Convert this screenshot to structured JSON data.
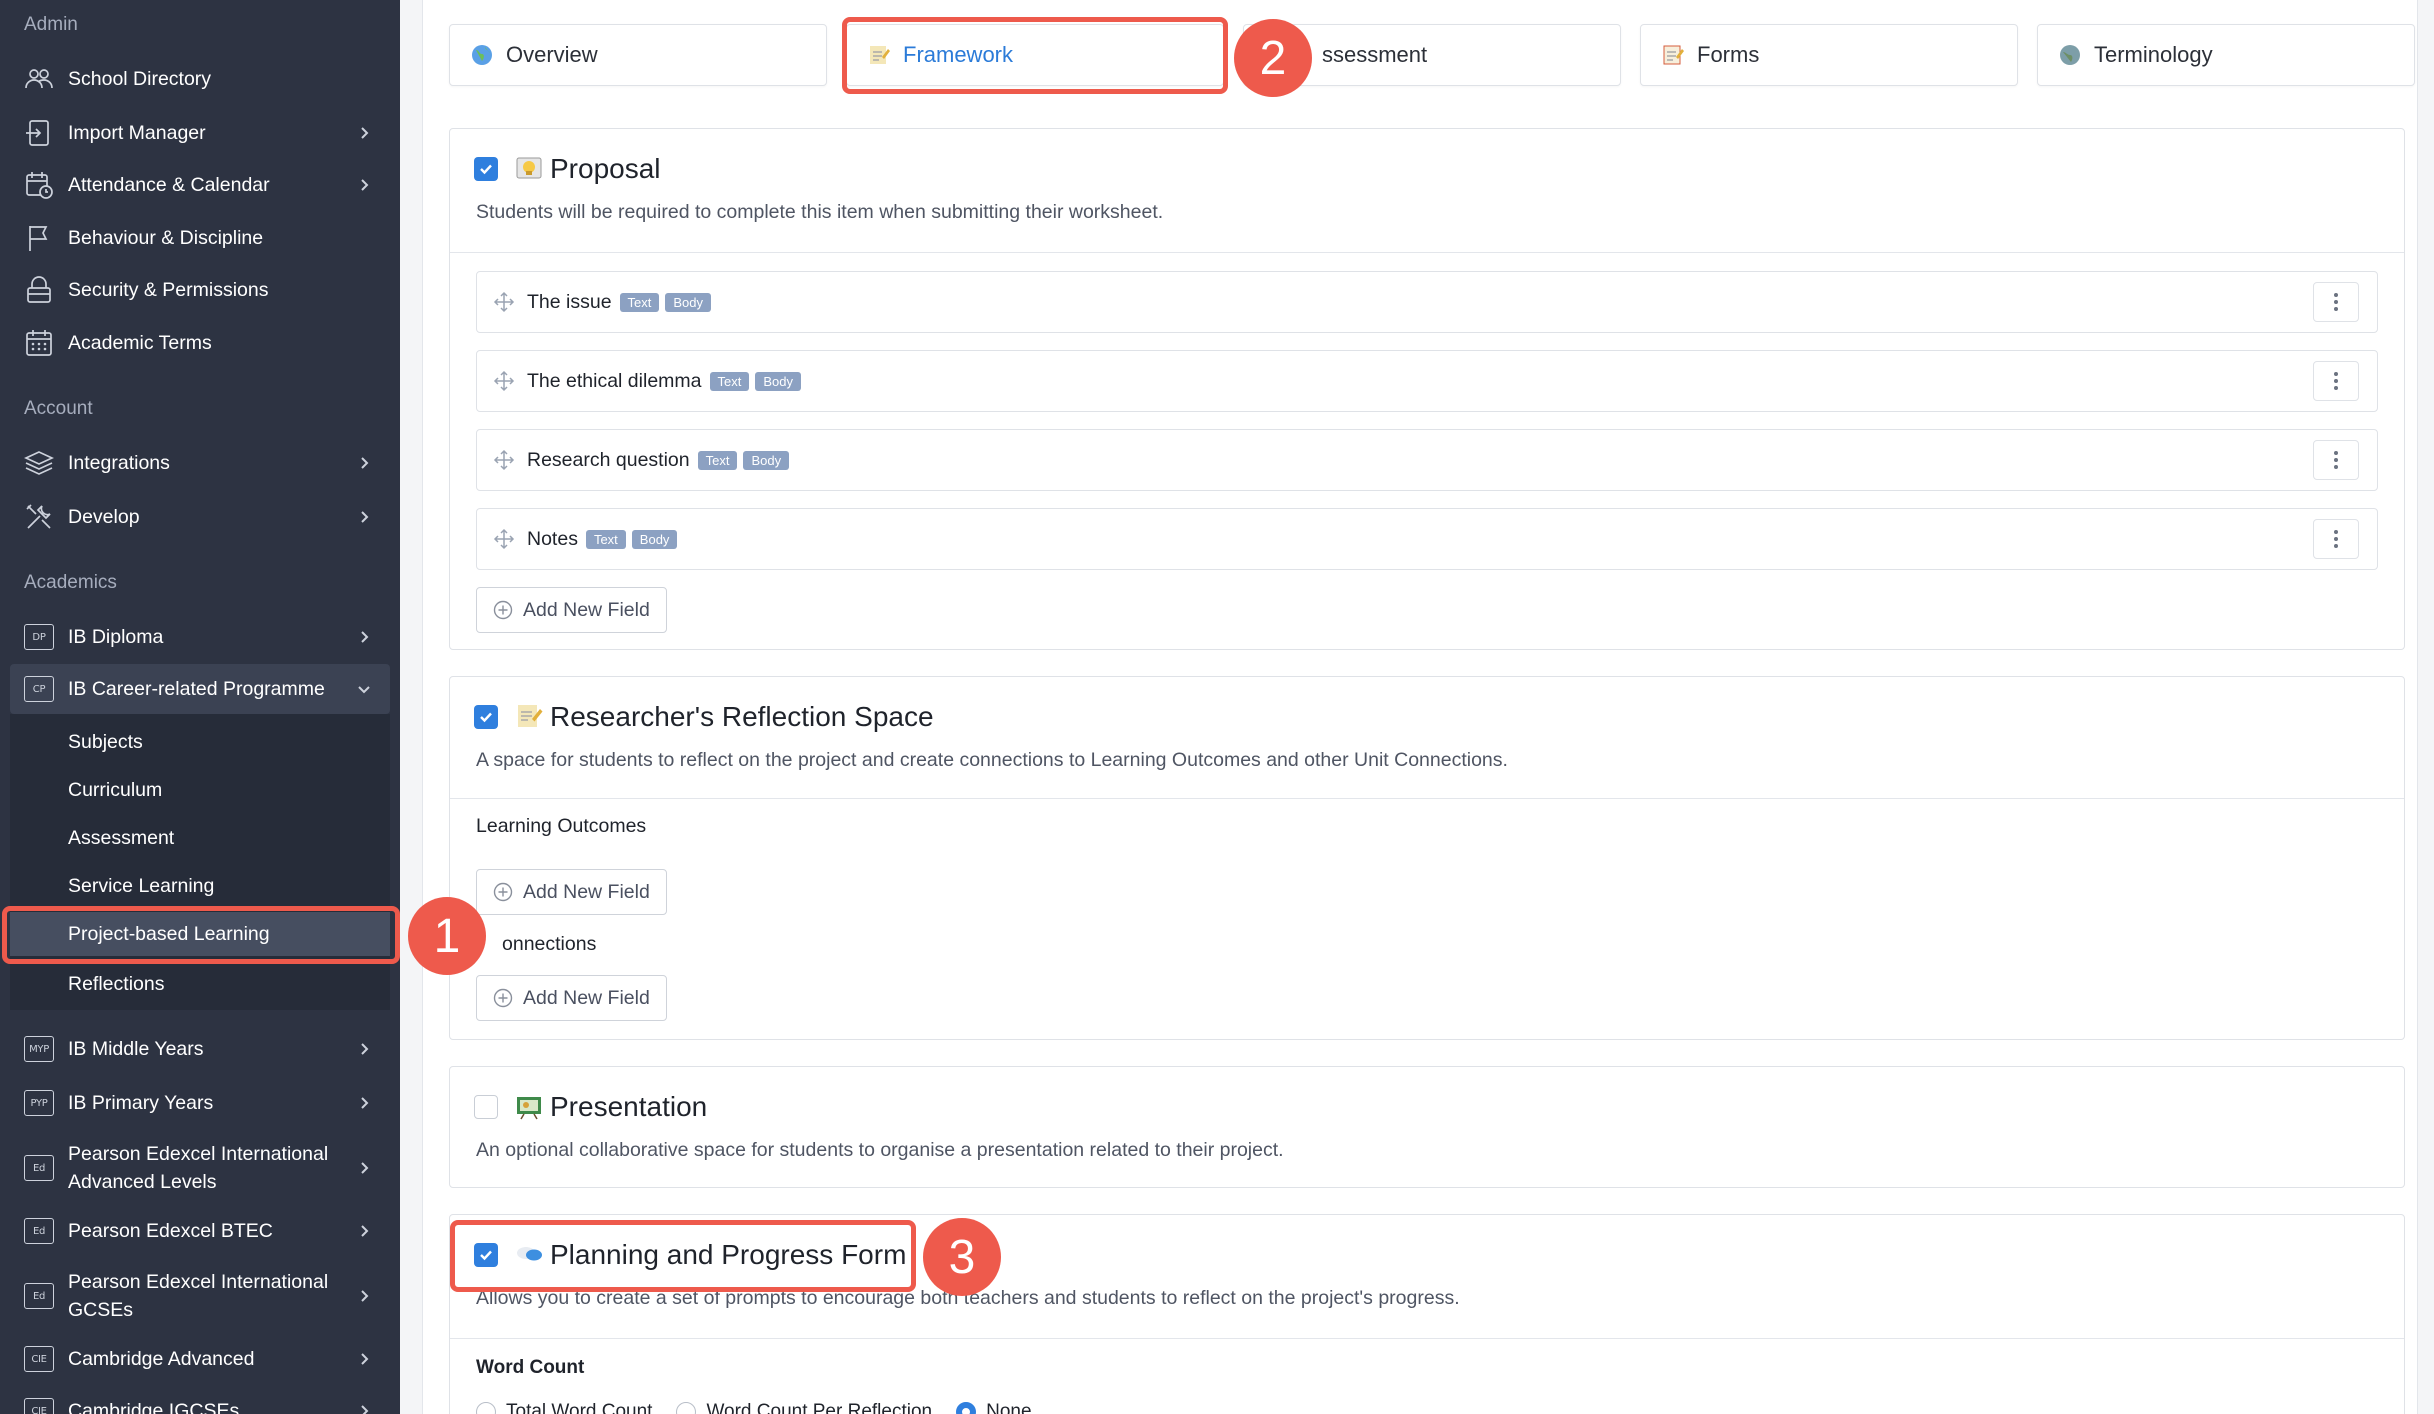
{
  "sidebar": {
    "sections": {
      "admin": "Admin",
      "account": "Account",
      "academics": "Academics"
    },
    "admin_items": [
      {
        "label": "School Directory",
        "icon": "people-icon"
      },
      {
        "label": "Import Manager",
        "icon": "import-icon"
      },
      {
        "label": "Attendance & Calendar",
        "icon": "calendar-clock-icon"
      },
      {
        "label": "Behaviour & Discipline",
        "icon": "flag-icon"
      },
      {
        "label": "Security & Permissions",
        "icon": "lock-icon"
      },
      {
        "label": "Academic Terms",
        "icon": "calendar-icon"
      }
    ],
    "account_items": [
      {
        "label": "Integrations",
        "icon": "layers-icon"
      },
      {
        "label": "Develop",
        "icon": "tools-icon"
      }
    ],
    "academic_items": [
      {
        "label": "IB Diploma",
        "badge": "DP"
      },
      {
        "label": "IB Career-related Programme",
        "badge": "CP"
      },
      {
        "label": "IB Middle Years",
        "badge": "MYP"
      },
      {
        "label": "IB Primary Years",
        "badge": "PYP"
      },
      {
        "label": "Pearson Edexcel International Advanced Levels",
        "badge": "Ed"
      },
      {
        "label": "Pearson Edexcel BTEC",
        "badge": "Ed"
      },
      {
        "label": "Pearson Edexcel International GCSEs",
        "badge": "Ed"
      },
      {
        "label": "Cambridge Advanced",
        "badge": "CIE"
      },
      {
        "label": "Cambridge IGCSEs",
        "badge": "CIE"
      }
    ],
    "cp_subitems": [
      "Subjects",
      "Curriculum",
      "Assessment",
      "Service Learning",
      "Project-based Learning",
      "Reflections"
    ]
  },
  "tabs": [
    {
      "label": "Overview",
      "icon": "globe-icon"
    },
    {
      "label": "Framework",
      "icon": "memo-icon",
      "selected": true
    },
    {
      "label": "ssessment",
      "icon": "none"
    },
    {
      "label": "Forms",
      "icon": "memo-icon"
    },
    {
      "label": "Terminology",
      "icon": "globe-icon"
    }
  ],
  "cards": {
    "proposal": {
      "title": "Proposal",
      "checked": true,
      "description": "Students will be required to complete this item when submitting their worksheet.",
      "fields": [
        {
          "name": "The issue",
          "tags": [
            "Text",
            "Body"
          ]
        },
        {
          "name": "The ethical dilemma",
          "tags": [
            "Text",
            "Body"
          ]
        },
        {
          "name": "Research question",
          "tags": [
            "Text",
            "Body"
          ]
        },
        {
          "name": "Notes",
          "tags": [
            "Text",
            "Body"
          ]
        }
      ],
      "add_label": "Add New Field"
    },
    "reflection": {
      "title": "Researcher's Reflection Space",
      "checked": true,
      "description": "A space for students to reflect on the project and create connections to Learning Outcomes and other Unit Connections.",
      "learning_outcomes": "Learning Outcomes",
      "connections": "onnections",
      "add_label": "Add New Field"
    },
    "presentation": {
      "title": "Presentation",
      "checked": false,
      "description": "An optional collaborative space for students to organise a presentation related to their project."
    },
    "planning": {
      "title": "Planning and Progress Form",
      "checked": true,
      "description": "Allows you to create a set of prompts to encourage both teachers and students to reflect on the project's progress.",
      "word_count_label": "Word Count",
      "options": [
        "Total Word Count",
        "Word Count Per Reflection",
        "None"
      ],
      "selected_option": "None"
    }
  },
  "annotations": [
    "1",
    "2",
    "3"
  ],
  "colors": {
    "sidebar_bg": "#2d3342",
    "accent": "#2f7fde",
    "annotation": "#ee5a4c",
    "tag_bg": "#8ca1c2"
  }
}
